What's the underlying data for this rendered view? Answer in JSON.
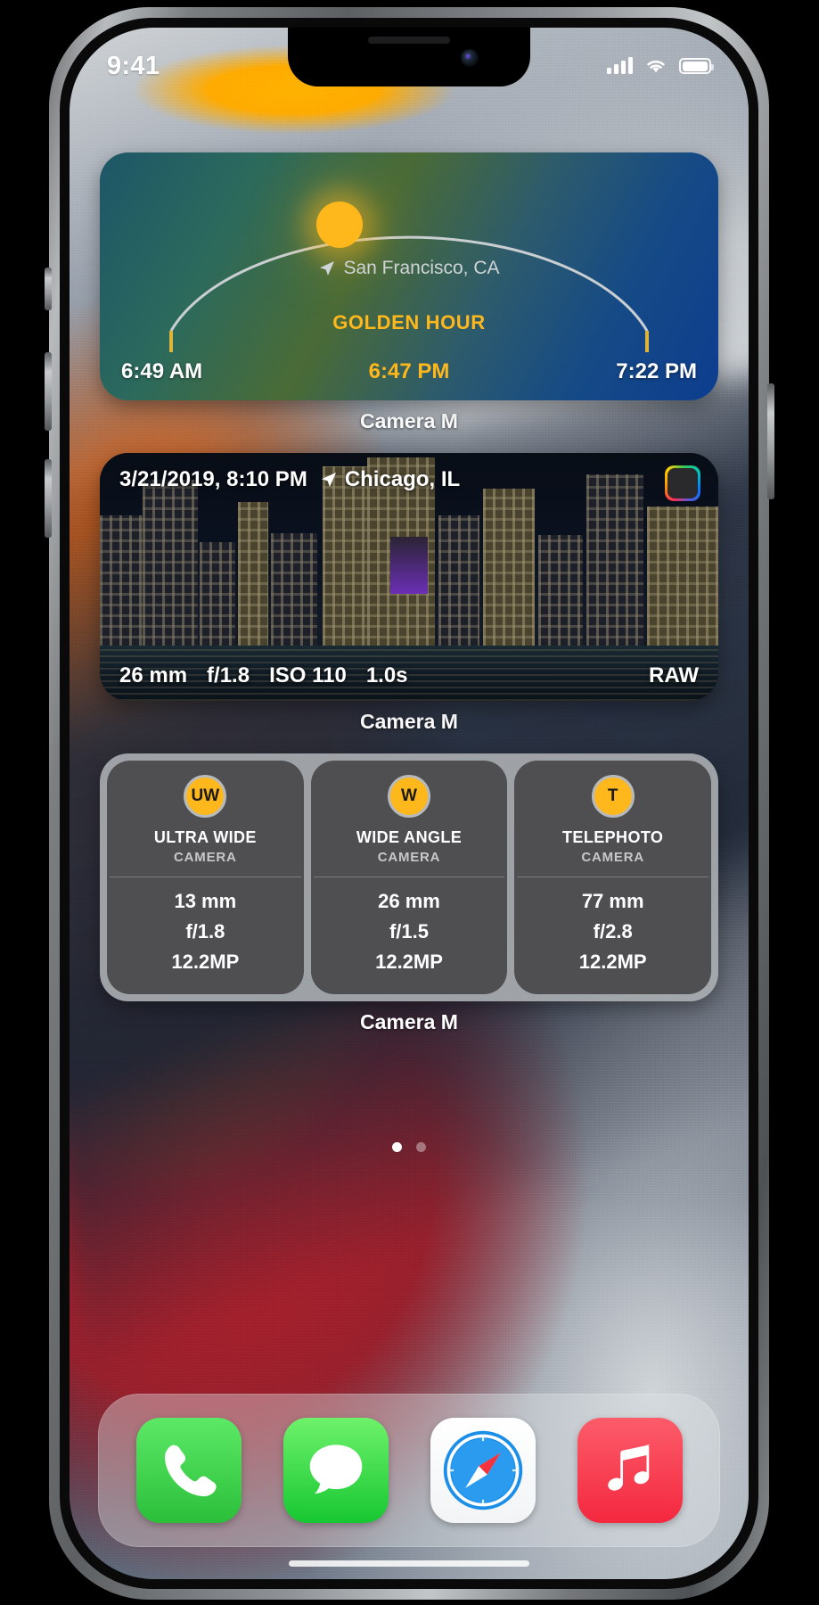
{
  "status_bar": {
    "time": "9:41",
    "signal_icon": "cellular-bars-icon",
    "wifi_icon": "wifi-icon",
    "battery_icon": "battery-full-icon"
  },
  "widgets": [
    {
      "id": "golden-hour",
      "label": "Camera M",
      "location": "San Francisco, CA",
      "location_icon": "location-arrow-icon",
      "heading": "GOLDEN HOUR",
      "sunrise": "6:49 AM",
      "golden_hour_time": "6:47 PM",
      "sunset": "7:22 PM",
      "accent_color": "#ffb81c"
    },
    {
      "id": "photo-exif",
      "label": "Camera M",
      "date": "3/21/2019, 8:10 PM",
      "location": "Chicago, IL",
      "location_icon": "location-arrow-icon",
      "badge_icon": "color-wheel-icon",
      "exif": {
        "focal_length": "26 mm",
        "aperture": "f/1.8",
        "iso": "ISO 110",
        "shutter": "1.0s",
        "format": "RAW"
      }
    },
    {
      "id": "camera-specs",
      "label": "Camera M",
      "columns": [
        {
          "badge": "UW",
          "title": "ULTRA WIDE",
          "subtitle": "CAMERA",
          "focal_length": "13 mm",
          "aperture": "f/1.8",
          "megapixels": "12.2MP"
        },
        {
          "badge": "W",
          "title": "WIDE ANGLE",
          "subtitle": "CAMERA",
          "focal_length": "26 mm",
          "aperture": "f/1.5",
          "megapixels": "12.2MP"
        },
        {
          "badge": "T",
          "title": "TELEPHOTO",
          "subtitle": "CAMERA",
          "focal_length": "77 mm",
          "aperture": "f/2.8",
          "megapixels": "12.2MP"
        }
      ]
    }
  ],
  "page_dots": {
    "count": 2,
    "active_index": 0
  },
  "dock": {
    "apps": [
      {
        "name": "Phone",
        "icon": "phone-icon"
      },
      {
        "name": "Messages",
        "icon": "message-bubble-icon"
      },
      {
        "name": "Safari",
        "icon": "compass-icon"
      },
      {
        "name": "Music",
        "icon": "music-note-icon"
      }
    ]
  }
}
